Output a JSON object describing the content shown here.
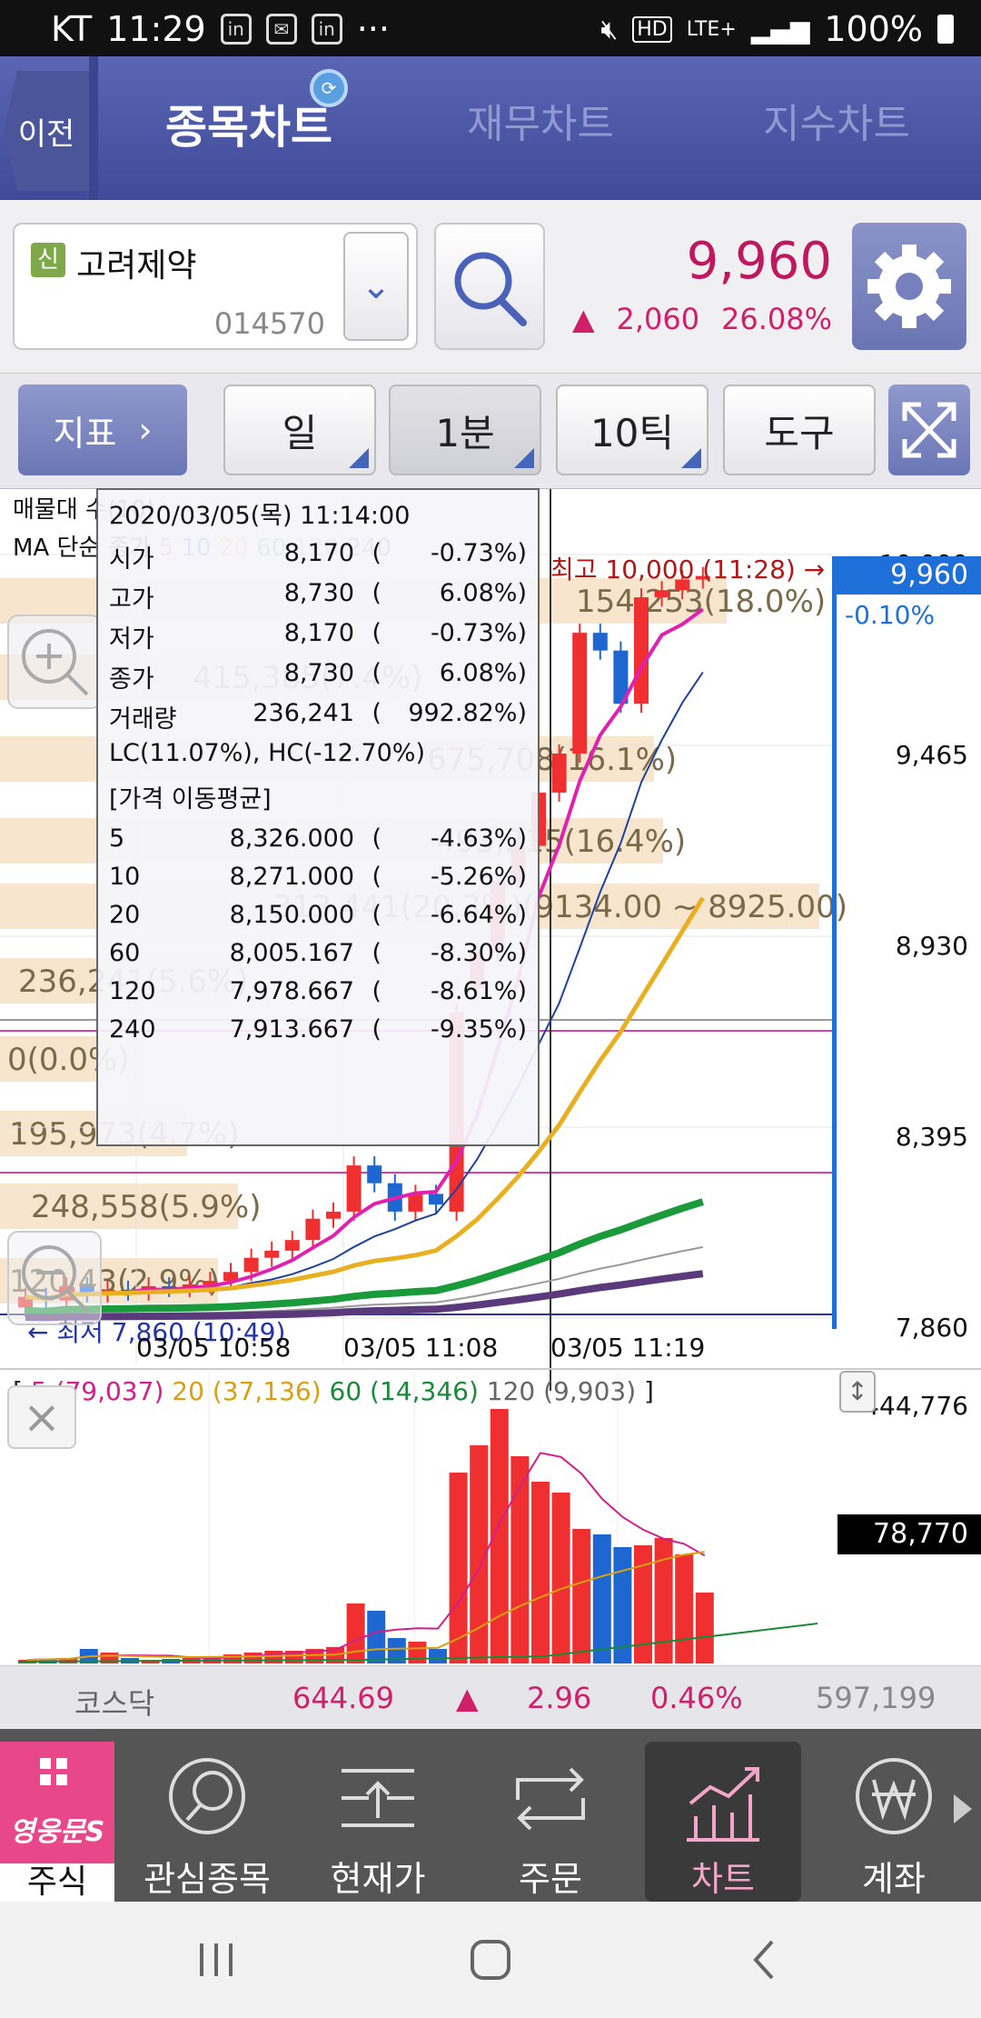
{
  "status_bar": {
    "carrier": "KT",
    "time": "11:29",
    "battery": "100%",
    "network": "LTE+"
  },
  "header": {
    "back_label": "이전",
    "tabs": [
      {
        "label": "종목차트",
        "active": true
      },
      {
        "label": "재무차트",
        "active": false
      },
      {
        "label": "지수차트",
        "active": false
      }
    ]
  },
  "stock": {
    "badge": "신",
    "name": "고려제약",
    "code": "014570",
    "price": "9,960",
    "change_arrow": "▲",
    "change": "2,060",
    "change_pct": "26.08%",
    "up_color": "#d0206a"
  },
  "toolbar": {
    "indicator_label": "지표",
    "period_day": "일",
    "period_min": "1분",
    "tick": "10틱",
    "tools": "도구"
  },
  "chart_legend": {
    "line1": "매물대 수(10)",
    "line2_prefix": "MA 단순",
    "ma_items": [
      {
        "label": "종가",
        "color": "#222222"
      },
      {
        "label": "5",
        "color": "#e040c0"
      },
      {
        "label": "10",
        "color": "#3050b0"
      },
      {
        "label": "20",
        "color": "#e8a818"
      },
      {
        "label": "60",
        "color": "#1a9a3a"
      },
      {
        "label": "120",
        "color": "#999999"
      },
      {
        "label": "240",
        "color": "#5a3a7a"
      }
    ]
  },
  "tooltip": {
    "datetime": "2020/03/05(목) 11:14:00",
    "ohlcv": [
      {
        "label": "시가",
        "value": "8,170",
        "pct": "-0.73%)"
      },
      {
        "label": "고가",
        "value": "8,730",
        "pct": "6.08%)"
      },
      {
        "label": "저가",
        "value": "8,170",
        "pct": "-0.73%)"
      },
      {
        "label": "종가",
        "value": "8,730",
        "pct": "6.08%)"
      },
      {
        "label": "거래량",
        "value": "236,241",
        "pct": "992.82%)"
      }
    ],
    "lchc": "LC(11.07%), HC(-12.70%)",
    "ma_title": "[가격 이동평균]",
    "ma": [
      {
        "label": "5",
        "value": "8,326.000",
        "pct": "-4.63%)"
      },
      {
        "label": "10",
        "value": "8,271.000",
        "pct": "-5.26%)"
      },
      {
        "label": "20",
        "value": "8,150.000",
        "pct": "-6.64%)"
      },
      {
        "label": "60",
        "value": "8,005.167",
        "pct": "-8.30%)"
      },
      {
        "label": "120",
        "value": "7,978.667",
        "pct": "-8.61%)"
      },
      {
        "label": "240",
        "value": "7,913.667",
        "pct": "-9.35%)"
      }
    ]
  },
  "volume_profile": [
    {
      "label": "154,253(18.0%)"
    },
    {
      "label": "415,385(7.4%)"
    },
    {
      "label": "675,708(16.1%)"
    },
    {
      "label": "493,215(16.4%)"
    },
    {
      "label": "313,441(20.3%)(9134.00 ~ 8925.00)"
    },
    {
      "label": "236,241(5.6%)"
    },
    {
      "label": "0(0.0%)"
    },
    {
      "label": "195,973(4.7%)"
    },
    {
      "label": "248,558(5.9%)"
    },
    {
      "label": "120,43(2.9%)"
    }
  ],
  "price_axis": [
    "9,465",
    "8,930",
    "8,395",
    "7,860"
  ],
  "price_axis_top": "10,000",
  "current_price_tag": "9,960",
  "current_change_tag": "-0.10%",
  "high_marker": "최고 10,000 (11:28) →",
  "low_marker": "← 최저 7,860 (10:49)",
  "time_axis": [
    "03/05 10:58",
    "03/05 11:08",
    "03/05 11:19"
  ],
  "volume_legend": [
    {
      "label": "5 (79,037)",
      "color": "#d0208a"
    },
    {
      "label": "20 (37,136)",
      "color": "#d8a010"
    },
    {
      "label": "60 (14,346)",
      "color": "#1a8a3a"
    },
    {
      "label": "120 (9,903)",
      "color": "#666666"
    }
  ],
  "volume_axis_max": "444,776",
  "volume_current_tag": "78,770",
  "index_bar": {
    "name": "코스닥",
    "value": "644.69",
    "arrow": "▲",
    "change": "2.96",
    "pct": "0.46%",
    "volume": "597,199"
  },
  "bottom_nav": {
    "brand": "영웅문S",
    "items": [
      {
        "label": "주식"
      },
      {
        "label": "관심종목"
      },
      {
        "label": "현재가"
      },
      {
        "label": "주문"
      },
      {
        "label": "차트"
      },
      {
        "label": "계좌"
      }
    ]
  },
  "chart_data": {
    "type": "candlestick",
    "title": "고려제약 1분",
    "ylim": [
      7860,
      10000
    ],
    "y_ticks": [
      7860,
      8395,
      8930,
      9465,
      10000
    ],
    "x_ticks": [
      "03/05 10:58",
      "03/05 11:08",
      "03/05 11:19"
    ],
    "candles_approx": [
      {
        "o": 7900,
        "c": 7930
      },
      {
        "o": 7930,
        "c": 7920
      },
      {
        "o": 7920,
        "c": 7960
      },
      {
        "o": 7960,
        "c": 7940
      },
      {
        "o": 7940,
        "c": 7950
      },
      {
        "o": 7950,
        "c": 7945
      },
      {
        "o": 7945,
        "c": 7960
      },
      {
        "o": 7960,
        "c": 7955
      },
      {
        "o": 7955,
        "c": 7965
      },
      {
        "o": 7965,
        "c": 7975
      },
      {
        "o": 7975,
        "c": 8000
      },
      {
        "o": 8000,
        "c": 8040
      },
      {
        "o": 8040,
        "c": 8060
      },
      {
        "o": 8060,
        "c": 8090
      },
      {
        "o": 8090,
        "c": 8150
      },
      {
        "o": 8150,
        "c": 8170
      },
      {
        "o": 8170,
        "c": 8300
      },
      {
        "o": 8300,
        "c": 8250
      },
      {
        "o": 8250,
        "c": 8170
      },
      {
        "o": 8170,
        "c": 8220
      },
      {
        "o": 8220,
        "c": 8190
      },
      {
        "o": 8170,
        "c": 8730
      },
      {
        "o": 8800,
        "c": 8900
      },
      {
        "o": 8900,
        "c": 9100
      },
      {
        "o": 9100,
        "c": 9200
      },
      {
        "o": 9200,
        "c": 9350
      },
      {
        "o": 9350,
        "c": 9460
      },
      {
        "o": 9460,
        "c": 9800
      },
      {
        "o": 9800,
        "c": 9750
      },
      {
        "o": 9750,
        "c": 9600
      },
      {
        "o": 9600,
        "c": 9900
      },
      {
        "o": 9900,
        "c": 9920
      },
      {
        "o": 9920,
        "c": 9950
      },
      {
        "o": 9950,
        "c": 9960
      }
    ],
    "volume_max": 444776,
    "volume_current": 78770
  }
}
